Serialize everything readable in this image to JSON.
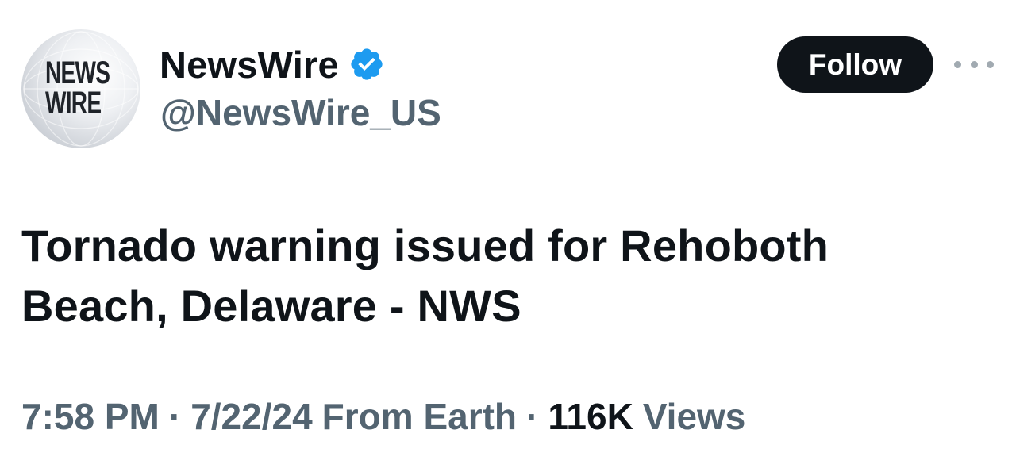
{
  "account": {
    "avatar_text_line1": "NEWS",
    "avatar_text_line2": "WIRE",
    "display_name": "NewsWire",
    "handle": "@NewsWire_US",
    "verified": true
  },
  "actions": {
    "follow_label": "Follow",
    "more_icon": "more-horizontal-icon"
  },
  "tweet": {
    "text_line1": "Tornado warning issued for Rehoboth",
    "text_line2": "Beach, Delaware - NWS"
  },
  "meta": {
    "time": "7:58 PM",
    "separator": "·",
    "date": "7/22/24",
    "source": "From Earth",
    "views_count": "116K",
    "views_label": "Views"
  },
  "colors": {
    "text_primary": "#0f1419",
    "text_secondary": "#536471",
    "verified_blue": "#1d9bf0",
    "follow_bg": "#0f1419",
    "follow_text": "#ffffff"
  }
}
